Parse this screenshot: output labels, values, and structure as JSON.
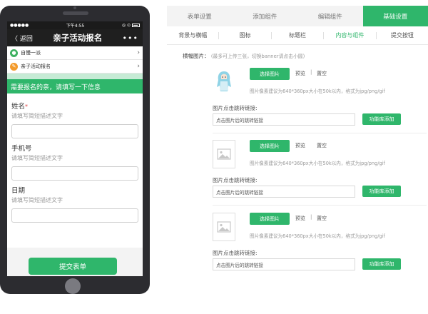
{
  "phone": {
    "status": {
      "carrier": "●●●●●",
      "wifi": "WiFi",
      "time": "下午4:55",
      "icons": "◎ ⊙"
    },
    "nav": {
      "back": "〈 返回",
      "title": "亲子活动报名",
      "more": "•••"
    },
    "rows": [
      {
        "label": "自慢一派",
        "icon": "location-icon",
        "icon_glyph": "●"
      },
      {
        "label": "亲子活动报名",
        "icon": "pencil-icon",
        "icon_glyph": "✎"
      }
    ],
    "notice": "需要报名的亲，请填写一下信息",
    "fields": [
      {
        "label": "姓名",
        "required_mark": "*",
        "desc": "请填写简短描述文字"
      },
      {
        "label": "手机号",
        "required_mark": "",
        "desc": "请填写简短描述文字"
      },
      {
        "label": "日期",
        "required_mark": "",
        "desc": "请填写简短描述文字"
      }
    ],
    "submit": "提交表单"
  },
  "editor": {
    "top_tabs": [
      "表单设置",
      "添加组件",
      "编辑组件",
      "基础设置"
    ],
    "sub_tabs": [
      "背景与横幅",
      "图标",
      "标题栏",
      "内容与组件",
      "提交按钮"
    ],
    "banner_label": "横幅图片：",
    "banner_hint": "(最多可上传三张，切换banner请点击小圆)",
    "blocks": [
      {
        "pick": "选择图片",
        "preview": "预览",
        "sep": "|",
        "clear": "置空",
        "size_hint": "图片像素建议为640*360px大小在50k以内，格式为jpg/png/gif",
        "link_label": "图片点击跳转链接:",
        "link_placeholder": "点击图片后的跳转链接",
        "lib_btn": "功能库添加"
      },
      {
        "pick": "选择图片",
        "preview": "预览",
        "sep": "",
        "clear": "置空",
        "size_hint": "图片像素建议为640*360px大小在50k以内，格式为jpg/png/gif",
        "link_label": "图片点击跳转链接:",
        "link_placeholder": "点击图片后的跳转链接",
        "lib_btn": "功能库添加"
      },
      {
        "pick": "选择图片",
        "preview": "预览",
        "sep": "|",
        "clear": "置空",
        "size_hint": "图片像素建议为640*360px大小在50k以内，格式为jpg/png/gif",
        "link_label": "图片点击跳转链接:",
        "link_placeholder": "点击图片后的跳转链接",
        "lib_btn": "功能库添加"
      }
    ]
  },
  "colors": {
    "accent": "#2fb66b",
    "dark": "#1f1f1f"
  }
}
